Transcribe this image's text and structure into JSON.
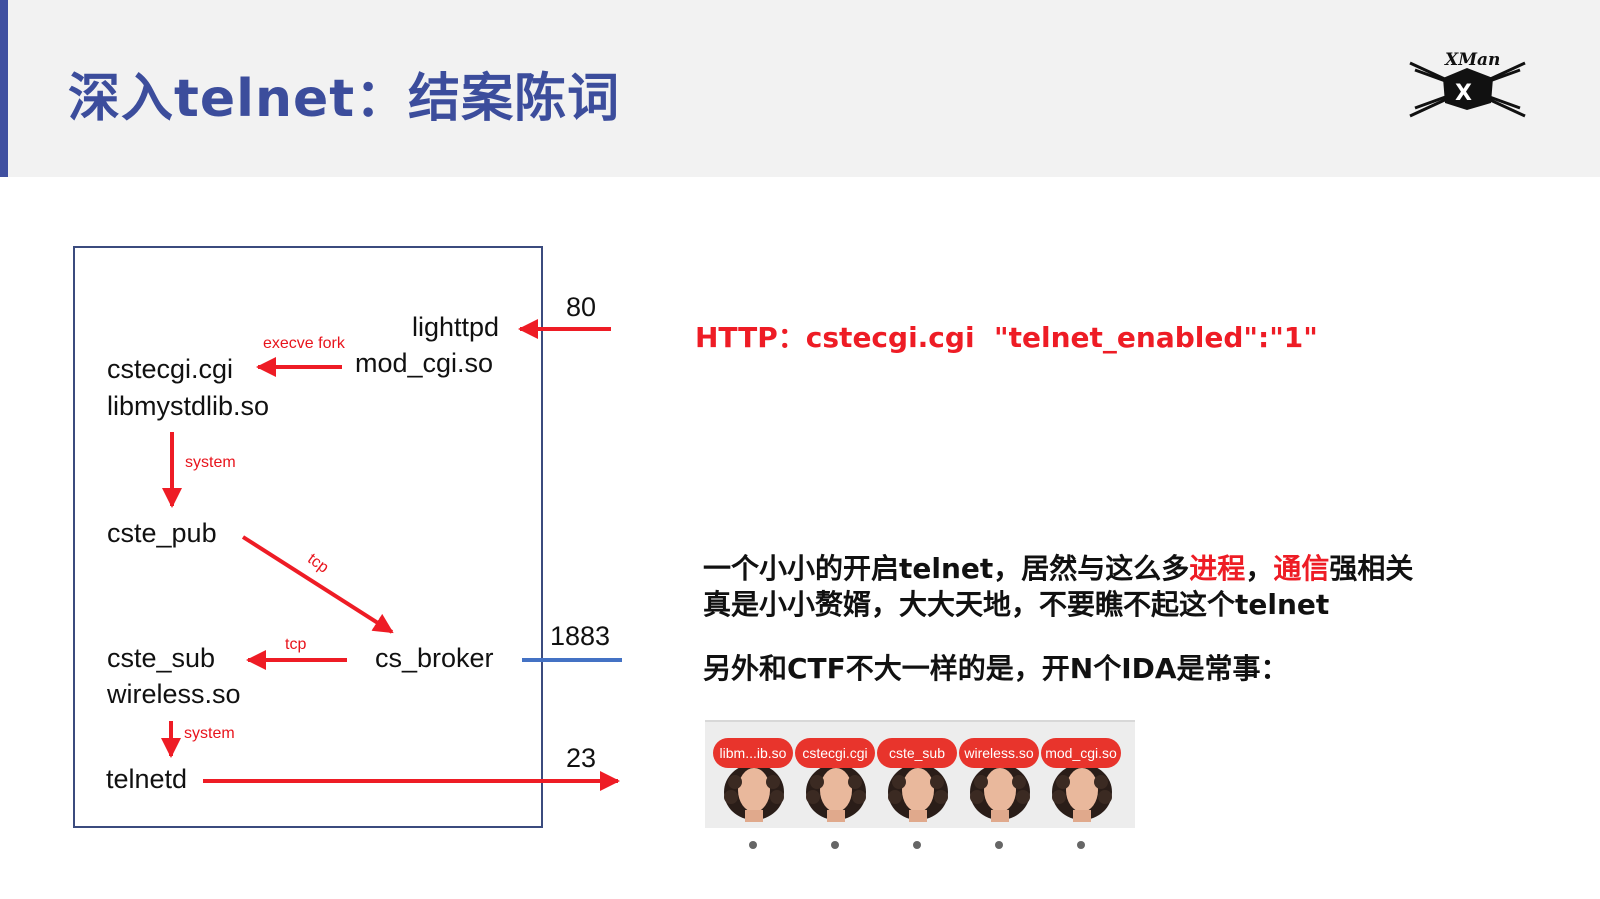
{
  "header": {
    "title": "深入telnet：结案陈词",
    "logo_text": "XMan",
    "accent_color": "#3f4fa0"
  },
  "diagram": {
    "nodes": {
      "lighttpd": "lighttpd",
      "mod_cgi": "mod_cgi.so",
      "cstecgi": "cstecgi.cgi",
      "libmystdlib": "libmystdlib.so",
      "cste_pub": "cste_pub",
      "cs_broker": "cs_broker",
      "cste_sub": "cste_sub",
      "wireless": "wireless.so",
      "telnetd": "telnetd"
    },
    "edge_labels": {
      "execve_fork": "execve fork",
      "system1": "system",
      "tcp1": "tcp",
      "tcp2": "tcp",
      "system2": "system"
    },
    "ports": {
      "http": "80",
      "broker": "1883",
      "telnet": "23"
    },
    "colors": {
      "arrow": "#ee1c25",
      "broker_line": "#4472c4",
      "box_border": "#3b4b7e"
    }
  },
  "notes": {
    "http_line": "HTTP：cstecgi.cgi  \"telnet_enabled\":\"1\"",
    "line1_a": "一个小小的开启telnet，居然与这么多",
    "line1_hl1": "进程",
    "line1_sep": "，",
    "line1_hl2": "通信",
    "line1_b": "强相关",
    "line2": "真是小小赘婿，大大天地，不要瞧不起这个telnet",
    "line3": "另外和CTF不大一样的是，开N个IDA是常事："
  },
  "ida_tabs": [
    {
      "label": "libm...ib.so",
      "icon": "ida-avatar-icon"
    },
    {
      "label": "cstecgi.cgi",
      "icon": "ida-avatar-icon"
    },
    {
      "label": "cste_sub",
      "icon": "ida-avatar-icon"
    },
    {
      "label": "wireless.so",
      "icon": "ida-avatar-icon"
    },
    {
      "label": "mod_cgi.so",
      "icon": "ida-avatar-icon"
    }
  ]
}
